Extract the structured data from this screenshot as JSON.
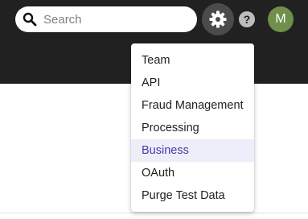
{
  "search": {
    "placeholder": "Search",
    "value": ""
  },
  "header": {
    "help_label": "?",
    "avatar_initial": "M"
  },
  "settings_menu": {
    "active_item": "Business",
    "items": [
      {
        "label": "Team"
      },
      {
        "label": "API"
      },
      {
        "label": "Fraud Management"
      },
      {
        "label": "Processing"
      },
      {
        "label": "Business"
      },
      {
        "label": "OAuth"
      },
      {
        "label": "Purge Test Data"
      }
    ]
  },
  "colors": {
    "topbar": "#212121",
    "gear_button_active": "#4b4b4b",
    "avatar": "#6f8f4a",
    "menu_active_bg": "#eeeefa",
    "menu_active_text": "#3f3fa6"
  },
  "icons": {
    "search": "search-icon",
    "settings": "gear-icon",
    "help": "help-icon"
  }
}
